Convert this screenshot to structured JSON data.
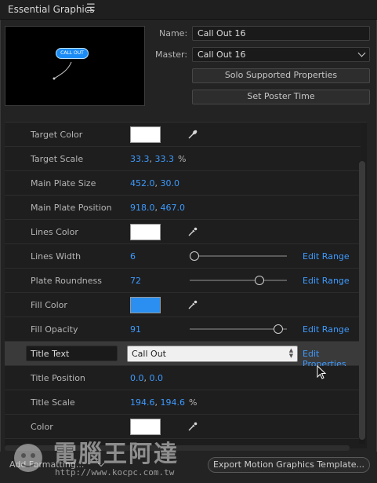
{
  "panel": {
    "title": "Essential Graphics",
    "menu_icon": "hamburger-menu-icon"
  },
  "preview": {
    "pill_text": "CALL OUT"
  },
  "info": {
    "name_label": "Name:",
    "name_value": "Call Out 16",
    "master_label": "Master:",
    "master_value": "Call Out 16",
    "solo_button": "Solo Supported Properties",
    "poster_button": "Set Poster Time"
  },
  "properties": {
    "target_color": {
      "label": "Target Color",
      "color": "#ffffff"
    },
    "target_scale": {
      "label": "Target Scale",
      "x": "33.3",
      "sep": ",",
      "y": "33.3",
      "unit": "%"
    },
    "main_plate_size": {
      "label": "Main Plate Size",
      "x": "452.0",
      "sep": ",",
      "y": "30.0"
    },
    "main_plate_position": {
      "label": "Main Plate Position",
      "x": "918.0",
      "sep": ",",
      "y": "467.0"
    },
    "lines_color": {
      "label": "Lines Color",
      "color": "#ffffff"
    },
    "lines_width": {
      "label": "Lines Width",
      "value": "6",
      "slider_fraction": 0.05,
      "edit": "Edit Range"
    },
    "plate_roundness": {
      "label": "Plate Roundness",
      "value": "72",
      "slider_fraction": 0.72,
      "edit": "Edit Range"
    },
    "fill_color": {
      "label": "Fill Color",
      "color": "#2a8ff0"
    },
    "fill_opacity": {
      "label": "Fill Opacity",
      "value": "91",
      "slider_fraction": 0.91,
      "edit": "Edit Range"
    },
    "title_text": {
      "label": "Title Text",
      "value": "Call Out",
      "edit": "Edit Properties"
    },
    "title_position": {
      "label": "Title Position",
      "x": "0.0",
      "sep": ",",
      "y": "0.0"
    },
    "title_scale": {
      "label": "Title Scale",
      "x": "194.6",
      "sep": ",",
      "y": "194.6",
      "unit": "%"
    },
    "color": {
      "label": "Color",
      "color": "#ffffff"
    }
  },
  "footer": {
    "add_formatting": "Add Formatting...",
    "export_button": "Export Motion Graphics Template..."
  },
  "watermark": {
    "text": "電腦王阿達",
    "url": "http://www.kocpc.com.tw"
  }
}
